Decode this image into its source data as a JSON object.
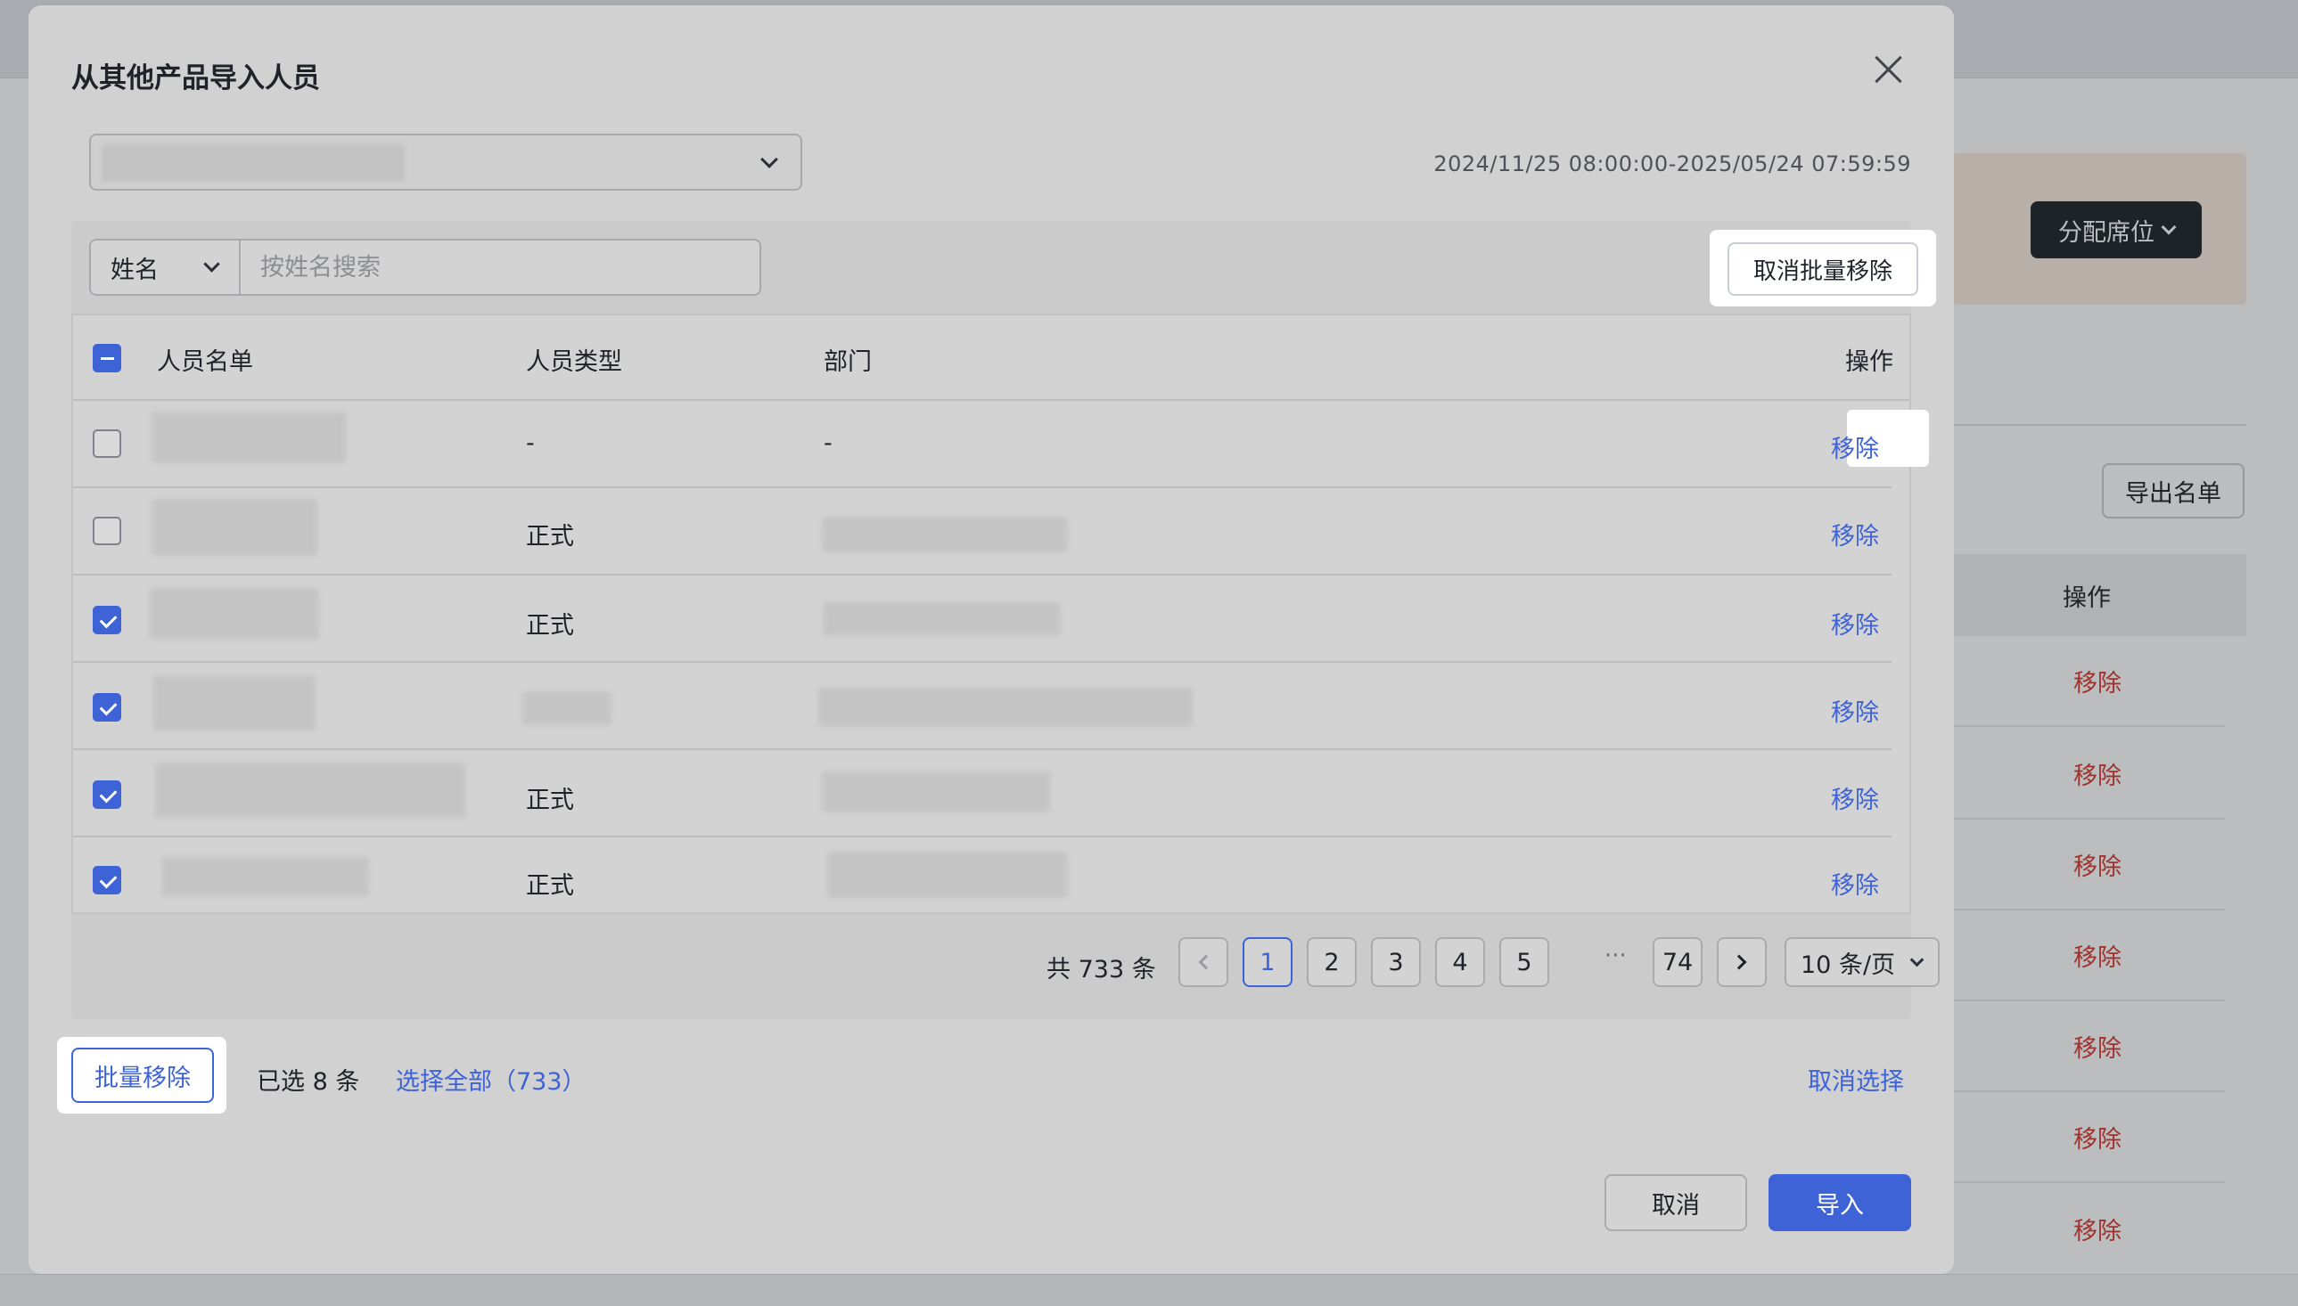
{
  "modal": {
    "title": "从其他产品导入人员",
    "date_range": "2024/11/25 08:00:00-2025/05/24 07:59:59"
  },
  "search": {
    "field": "姓名",
    "placeholder": "按姓名搜索"
  },
  "toolbar": {
    "cancel_batch_label": "取消批量移除"
  },
  "table": {
    "headers": [
      "人员名单",
      "人员类型",
      "部门",
      "操作"
    ],
    "rows": [
      {
        "type": "-",
        "dept": "-",
        "action": "移除",
        "checked": false
      },
      {
        "type": "正式",
        "dept": "",
        "action": "移除",
        "checked": false
      },
      {
        "type": "正式",
        "dept": "",
        "action": "移除",
        "checked": true
      },
      {
        "type": "",
        "dept": "",
        "action": "移除",
        "checked": true
      },
      {
        "type": "正式",
        "dept": "",
        "action": "移除",
        "checked": true
      },
      {
        "type": "正式",
        "dept": "",
        "action": "移除",
        "checked": true
      }
    ]
  },
  "pagination": {
    "total": "共 733 条",
    "pages": [
      "1",
      "2",
      "3",
      "4",
      "5"
    ],
    "ellipsis": "···",
    "last": "74",
    "page_size": "10 条/页",
    "current": "1"
  },
  "batch": {
    "batch_remove_label": "批量移除",
    "selected_text": "已选 8 条",
    "select_all_label": "选择全部（733）",
    "cancel_select_label": "取消选择"
  },
  "footer": {
    "cancel_label": "取消",
    "import_label": "导入"
  },
  "background": {
    "assign_seat_label": "分配席位",
    "export_label": "导出名单",
    "action_header": "操作",
    "remove_labels": [
      "移除",
      "移除",
      "移除",
      "移除",
      "移除",
      "移除",
      "移除"
    ]
  },
  "colors": {
    "primary": "#3d63d6",
    "danger": "#d83931"
  },
  "icons": {
    "close": "close-icon",
    "dropdown": "chevron-down-icon",
    "prev": "chevron-left-icon",
    "next": "chevron-right-icon"
  }
}
